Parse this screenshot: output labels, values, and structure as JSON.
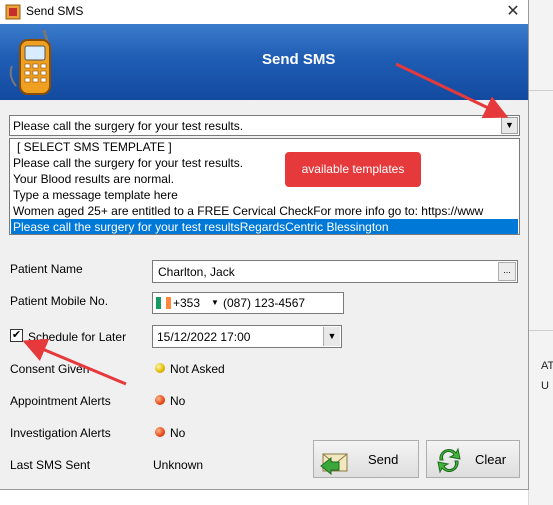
{
  "window": {
    "title": "Send SMS",
    "close_glyph": "✕"
  },
  "header": {
    "title": "Send SMS"
  },
  "template_select": {
    "value": "Please call the surgery for your test results.",
    "options": [
      "[ SELECT SMS TEMPLATE ]",
      "Please call the surgery for your test results.",
      "Your Blood results are normal.",
      "Type a message template here",
      "Women aged 25+ are entitled to a FREE Cervical CheckFor more info go to: https://www",
      "Please call the surgery for your test resultsRegardsCentric Blessington"
    ],
    "selected_index": 5
  },
  "annotation": {
    "tooltip": "available templates",
    "color": "#e5393c"
  },
  "patient_name": {
    "label": "Patient Name",
    "value": "Charlton, Jack",
    "browse_label": "..."
  },
  "mobile": {
    "label": "Patient Mobile No.",
    "country_code": "+353",
    "number": "(087) 123-4567"
  },
  "schedule": {
    "label": "Schedule for Later",
    "checked": true,
    "check_glyph": "✔",
    "value": "15/12/2022 17:00"
  },
  "consent": {
    "label": "Consent Given",
    "status": "Not Asked",
    "status_color": "yellow"
  },
  "appointment_alerts": {
    "label": "Appointment Alerts",
    "status": "No",
    "status_color": "red"
  },
  "investigation_alerts": {
    "label": "Investigation Alerts",
    "status": "No",
    "status_color": "red"
  },
  "last_sms": {
    "label": "Last SMS Sent",
    "value": "Unknown"
  },
  "buttons": {
    "send": "Send",
    "clear": "Clear"
  },
  "background_window": {
    "frag1": "ATI",
    "frag2": "U"
  },
  "colors": {
    "header_blue": "#1f5db4",
    "selection_blue": "#0078d7",
    "arrow_red": "#e5393c"
  }
}
